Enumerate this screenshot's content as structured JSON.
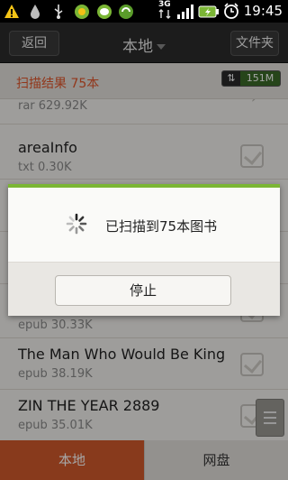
{
  "status_bar": {
    "time": "19:45",
    "network": "3G"
  },
  "top_bar": {
    "back_label": "返回",
    "title": "本地",
    "folder_label": "文件夹"
  },
  "scan_header": {
    "text": "扫描结果 75本",
    "storage": "151M"
  },
  "books": [
    {
      "title": "",
      "meta": "rar  629.92K"
    },
    {
      "title": "areaInfo",
      "meta": "txt  0.30K"
    },
    {
      "title": "",
      "meta": ""
    },
    {
      "title": "",
      "meta": ""
    },
    {
      "title": "",
      "meta": "epub  30.33K"
    },
    {
      "title": "The Man Who Would Be King",
      "meta": "epub  38.19K"
    },
    {
      "title": "ZIN THE YEAR 2889",
      "meta": "epub  35.01K"
    }
  ],
  "dialog": {
    "message": "已扫描到75本图书",
    "stop_label": "停止"
  },
  "tabs": {
    "local": "本地",
    "cloud": "网盘"
  },
  "colors": {
    "accent_orange": "#d15a2c",
    "dialog_green": "#7bb635",
    "storage_green": "#3b6b28"
  }
}
